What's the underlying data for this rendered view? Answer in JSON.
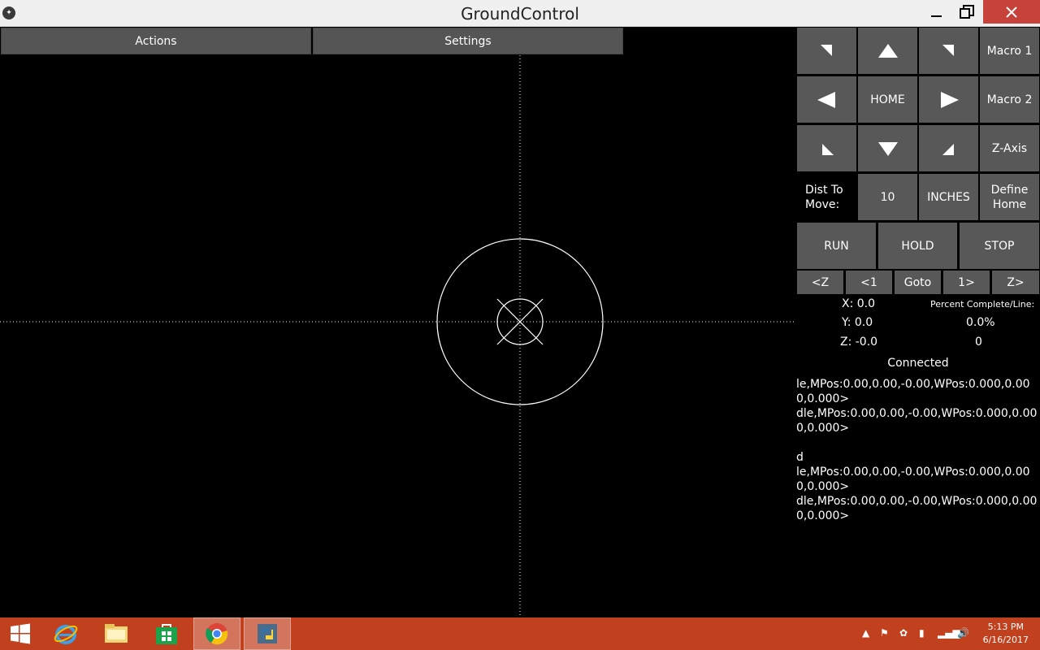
{
  "window": {
    "title": "GroundControl"
  },
  "menu": {
    "actions": "Actions",
    "settings": "Settings"
  },
  "jog": {
    "macro1": "Macro 1",
    "home": "HOME",
    "macro2": "Macro 2",
    "zaxis": "Z-Axis",
    "dist_label": "Dist To Move:",
    "dist_value": "10",
    "units": "INCHES",
    "define_home": "Define Home"
  },
  "run_controls": {
    "run": "RUN",
    "hold": "HOLD",
    "stop": "STOP"
  },
  "line_controls": {
    "z_back": "<Z",
    "back1": "<1",
    "goto": "Goto",
    "fwd1": "1>",
    "z_fwd": "Z>"
  },
  "position": {
    "x": "X: 0.0",
    "y": "Y: 0.0",
    "z": "Z: -0.0"
  },
  "progress": {
    "label": "Percent Complete/Line:",
    "percent": "0.0%",
    "line": "0"
  },
  "status": "Connected",
  "console": [
    "le,MPos:0.00,0.00,-0.00,WPos:0.000,0.000,0.000>",
    "dle,MPos:0.00,0.00,-0.00,WPos:0.000,0.000,0.000>",
    "",
    "d",
    "le,MPos:0.00,0.00,-0.00,WPos:0.000,0.000,0.000>",
    "dle,MPos:0.00,0.00,-0.00,WPos:0.000,0.000,0.000>"
  ],
  "taskbar": {
    "time": "5:13 PM",
    "date": "6/16/2017"
  },
  "colors": {
    "titlebar": "#f0f0f0",
    "close": "#c7423a",
    "button": "#585858",
    "taskbar": "#c1411e",
    "canvas": "#000000"
  }
}
